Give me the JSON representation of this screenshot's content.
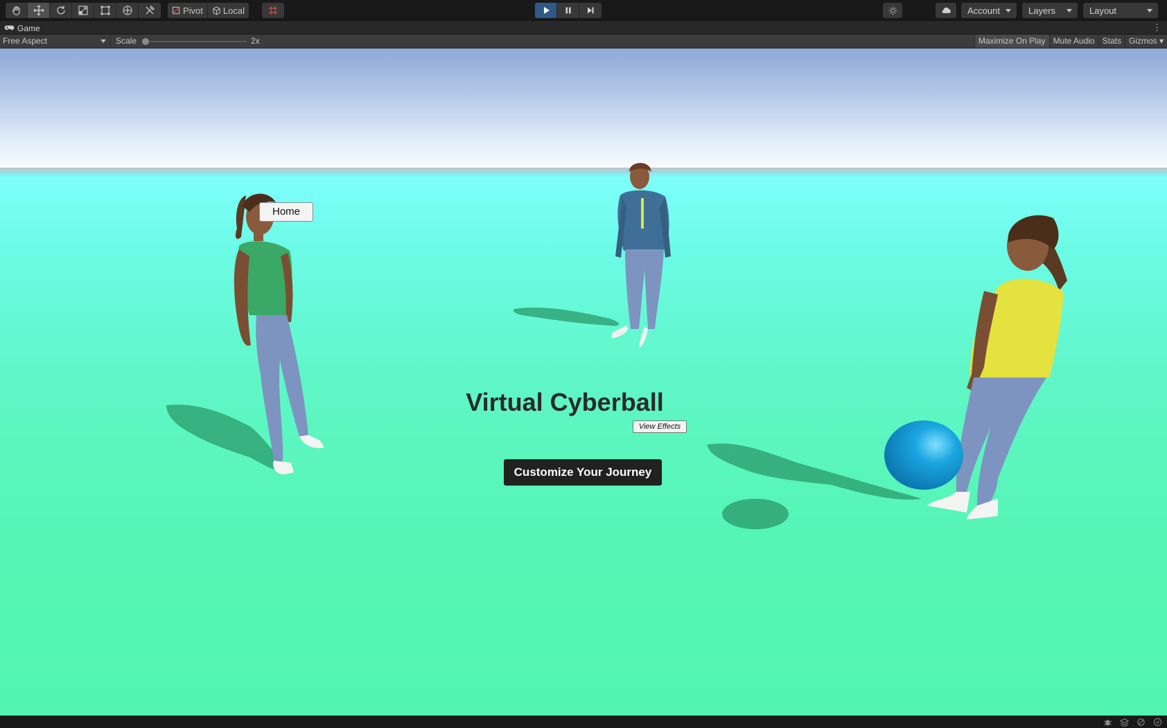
{
  "toolbar": {
    "tools": [
      {
        "name": "hand-tool",
        "icon": "hand-icon"
      },
      {
        "name": "move-tool",
        "icon": "move-icon",
        "active": true
      },
      {
        "name": "rotate-tool",
        "icon": "rotate-icon"
      },
      {
        "name": "scale-tool",
        "icon": "scale-icon"
      },
      {
        "name": "rect-tool",
        "icon": "rect-icon"
      },
      {
        "name": "transform-tool",
        "icon": "transform-icon"
      },
      {
        "name": "custom-tool",
        "icon": "tools-icon"
      }
    ],
    "pivot_label": "Pivot",
    "local_label": "Local",
    "account_label": "Account",
    "layers_label": "Layers",
    "layout_label": "Layout",
    "play_accent": "#2e5a8a"
  },
  "tab": {
    "label": "Game"
  },
  "game_toolbar": {
    "aspect_label": "Free Aspect",
    "scale_label": "Scale",
    "scale_value": "2x",
    "maximize_label": "Maximize On Play",
    "mute_label": "Mute Audio",
    "stats_label": "Stats",
    "gizmos_label": "Gizmos"
  },
  "game": {
    "home_button": "Home",
    "title": "Virtual Cyberball",
    "view_effects_button": "View Effects",
    "customize_button": "Customize Your Journey",
    "ground_color": "#55f5b5",
    "ball_color": "#1aa6e0"
  }
}
